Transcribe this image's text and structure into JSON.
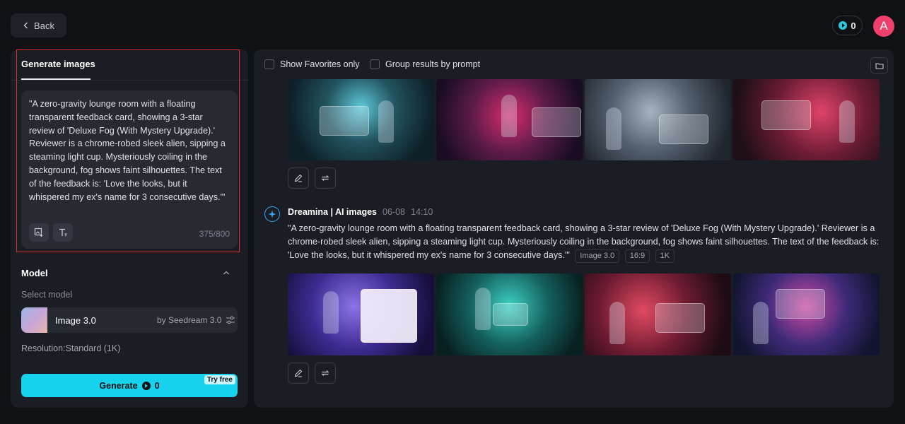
{
  "header": {
    "back_label": "Back",
    "credits": "0",
    "avatar_letter": "A"
  },
  "left_panel": {
    "tab_label": "Generate images",
    "prompt_text": "\"A zero-gravity lounge room with a floating transparent feedback card, showing a 3-star review of 'Deluxe Fog (With Mystery Upgrade).' Reviewer is a chrome-robed sleek alien, sipping a steaming light cup. Mysteriously coiling in the background, fog shows faint silhouettes. The text of the feedback is: 'Love the looks, but it whispered my ex's name for 3 consecutive days.'\"",
    "char_count": "375/800",
    "model_section_title": "Model",
    "select_model_label": "Select model",
    "model_name": "Image 3.0",
    "model_provider": "by Seedream 3.0",
    "resolution_label": "Resolution:Standard (1K)",
    "generate_label": "Generate",
    "generate_cost": "0",
    "try_free_label": "Try free"
  },
  "right_panel": {
    "filters": {
      "favorites_label": "Show Favorites only",
      "group_label": "Group results by prompt"
    },
    "entry": {
      "author": "Dreamina | AI images",
      "date": "06-08",
      "time": "14:10",
      "prompt": "\"A zero-gravity lounge room with a floating transparent feedback card, showing a 3-star review of 'Deluxe Fog (With Mystery Upgrade).' Reviewer is a chrome-robed sleek alien, sipping a steaming light cup. Mysteriously coiling in the background, fog shows faint silhouettes. The text of the feedback is: 'Love the looks, but it whispered my ex's name for 3 consecutive days.'\"",
      "tags": [
        "Image 3.0",
        "16:9",
        "1K"
      ]
    }
  },
  "colors": {
    "accent": "#17d2ec",
    "avatar": "#ef3f6c",
    "highlight": "#e32b2b"
  }
}
